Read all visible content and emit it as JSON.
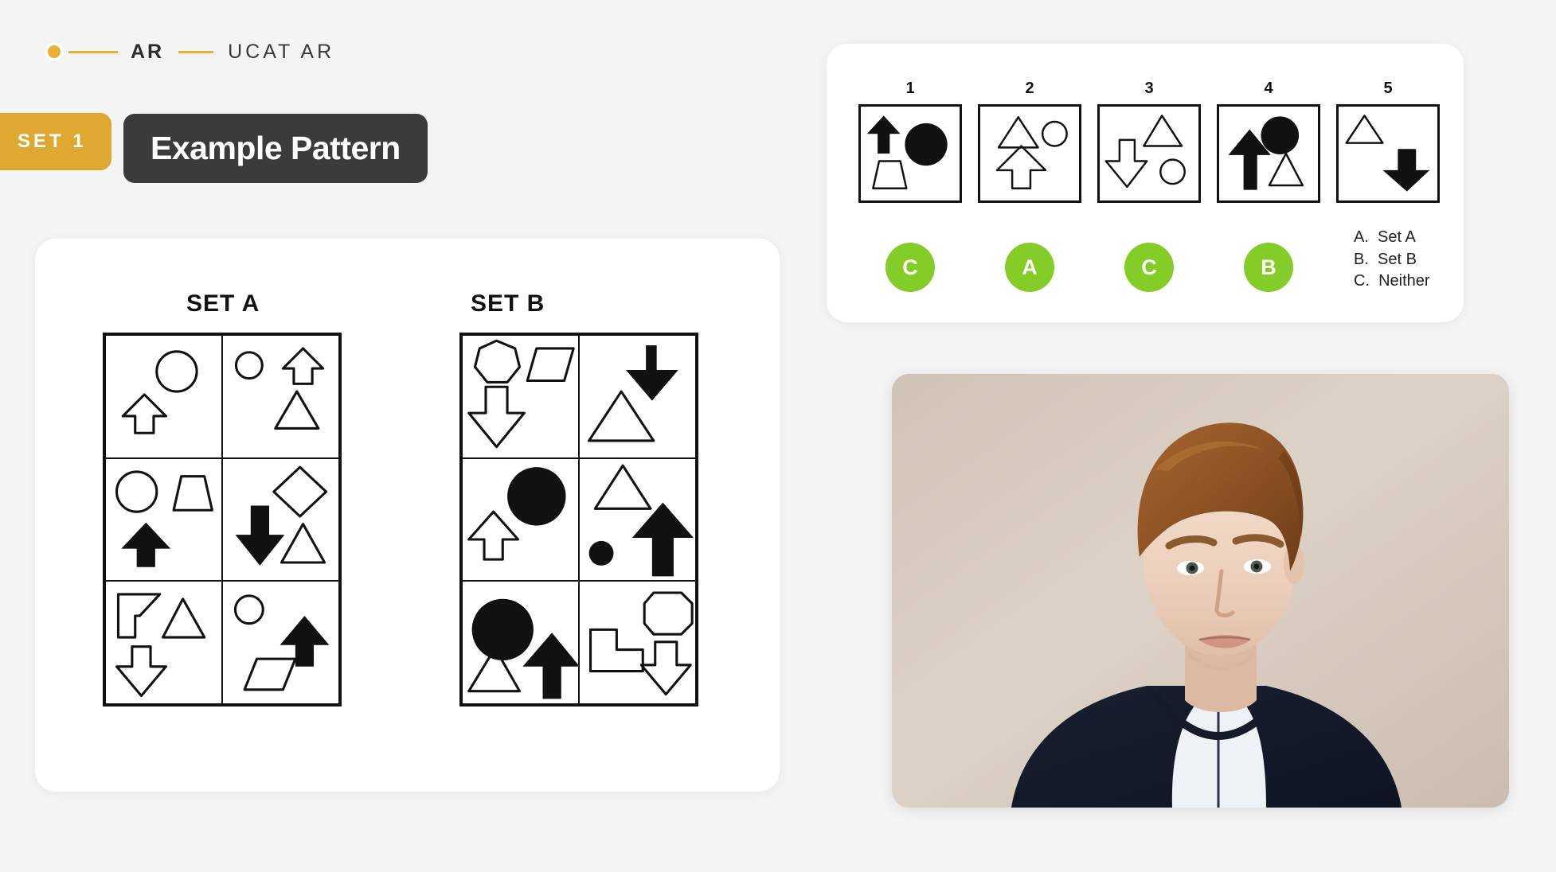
{
  "breadcrumb": {
    "dot_icon": "progress-dot-icon",
    "step_label": "AR",
    "section_label": "UCAT AR",
    "accent_color": "#eab033"
  },
  "header": {
    "set_badge": "SET 1",
    "title": "Example Pattern",
    "badge_color": "#dfa833",
    "title_pill_color": "#3b3b3b"
  },
  "example_panel": {
    "set_a_label": "SET A",
    "set_b_label": "SET B",
    "set_a_cells": [
      {
        "position": "row1-col1",
        "shapes": [
          "circle-outline",
          "arrow-up-outline"
        ]
      },
      {
        "position": "row1-col2",
        "shapes": [
          "circle-outline-small",
          "arrow-up-outline",
          "triangle-outline"
        ]
      },
      {
        "position": "row2-col1",
        "shapes": [
          "circle-outline",
          "trapezoid-outline",
          "arrow-up-filled"
        ]
      },
      {
        "position": "row2-col2",
        "shapes": [
          "diamond-outline",
          "arrow-down-filled",
          "triangle-outline"
        ]
      },
      {
        "position": "row3-col1",
        "shapes": [
          "corner-flag-outline",
          "triangle-outline",
          "arrow-down-outline"
        ]
      },
      {
        "position": "row3-col2",
        "shapes": [
          "circle-outline-small",
          "arrow-up-filled",
          "parallelogram-outline"
        ]
      }
    ],
    "set_b_cells": [
      {
        "position": "row1-col1",
        "shapes": [
          "heptagon-outline",
          "parallelogram-outline",
          "arrow-down-outline"
        ]
      },
      {
        "position": "row1-col2",
        "shapes": [
          "arrow-down-filled",
          "triangle-outline"
        ]
      },
      {
        "position": "row2-col1",
        "shapes": [
          "circle-filled",
          "arrow-up-outline"
        ]
      },
      {
        "position": "row2-col2",
        "shapes": [
          "triangle-outline",
          "circle-filled-small",
          "arrow-up-filled"
        ]
      },
      {
        "position": "row3-col1",
        "shapes": [
          "circle-filled",
          "triangle-outline",
          "arrow-up-filled"
        ]
      },
      {
        "position": "row3-col2",
        "shapes": [
          "l-shape-outline",
          "rounded-octagon-outline",
          "arrow-down-outline"
        ]
      }
    ]
  },
  "question_panel": {
    "items": [
      {
        "number": "1",
        "answer": "C",
        "shapes": [
          "arrow-up-filled",
          "circle-filled",
          "trapezoid-outline"
        ]
      },
      {
        "number": "2",
        "answer": "A",
        "shapes": [
          "triangle-outline",
          "circle-outline",
          "arrow-up-outline"
        ]
      },
      {
        "number": "3",
        "answer": "C",
        "shapes": [
          "triangle-outline",
          "arrow-down-outline",
          "circle-outline"
        ]
      },
      {
        "number": "4",
        "answer": "B",
        "shapes": [
          "circle-filled",
          "arrow-up-filled",
          "triangle-outline"
        ]
      },
      {
        "number": "5",
        "answer": "",
        "shapes": [
          "triangle-outline",
          "arrow-down-filled"
        ]
      }
    ],
    "answer_badge_color": "#84cc28",
    "legend": [
      "A.  Set A",
      "B.  Set B",
      "C.  Neither"
    ]
  },
  "webcam": {
    "label": "presenter-video-feed"
  }
}
